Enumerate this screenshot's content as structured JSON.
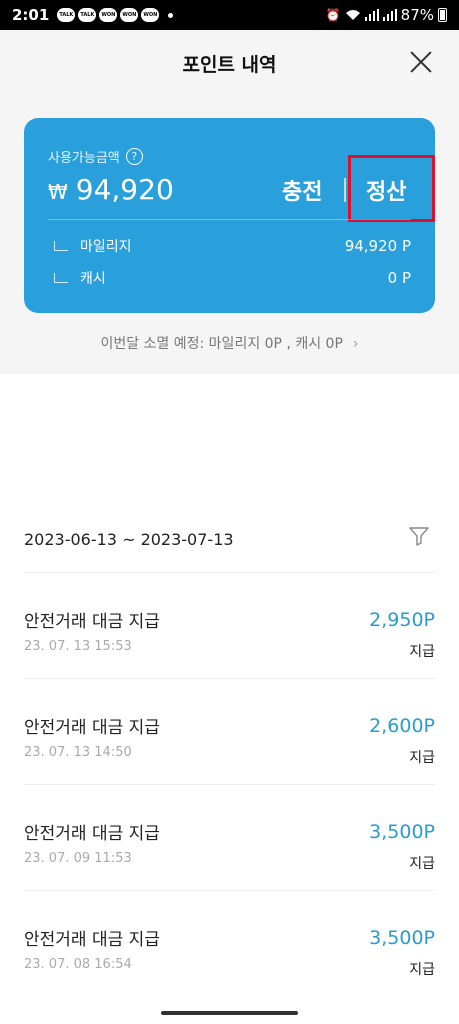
{
  "status_bar": {
    "time": "2:01",
    "notifications": [
      "TALK",
      "TALK",
      "WON",
      "WON",
      "WON"
    ],
    "battery": "87%"
  },
  "header": {
    "title": "포인트 내역",
    "close_icon": "close-icon"
  },
  "card": {
    "available_label": "사용가능금액",
    "help_symbol": "?",
    "currency_symbol": "₩",
    "amount": "94,920",
    "charge_label": "충전",
    "settle_label": "정산",
    "rows": [
      {
        "label": "마일리지",
        "value": "94,920 P"
      },
      {
        "label": "캐시",
        "value": "0 P"
      }
    ],
    "colors": {
      "background": "#29a0db",
      "highlight_border": "#e0102b"
    }
  },
  "expire_notice": "이번달 소멸 예정: 마일리지 0P , 캐시 0P",
  "filter": {
    "date_range": "2023-06-13 ~ 2023-07-13"
  },
  "transactions": [
    {
      "title": "안전거래 대금 지급",
      "date": "23. 07. 13 15:53",
      "amount": "2,950P",
      "type": "지급"
    },
    {
      "title": "안전거래 대금 지급",
      "date": "23. 07. 13 14:50",
      "amount": "2,600P",
      "type": "지급"
    },
    {
      "title": "안전거래 대금 지급",
      "date": "23. 07. 09 11:53",
      "amount": "3,500P",
      "type": "지급"
    },
    {
      "title": "안전거래 대금 지급",
      "date": "23. 07. 08 16:54",
      "amount": "3,500P",
      "type": "지급"
    }
  ]
}
